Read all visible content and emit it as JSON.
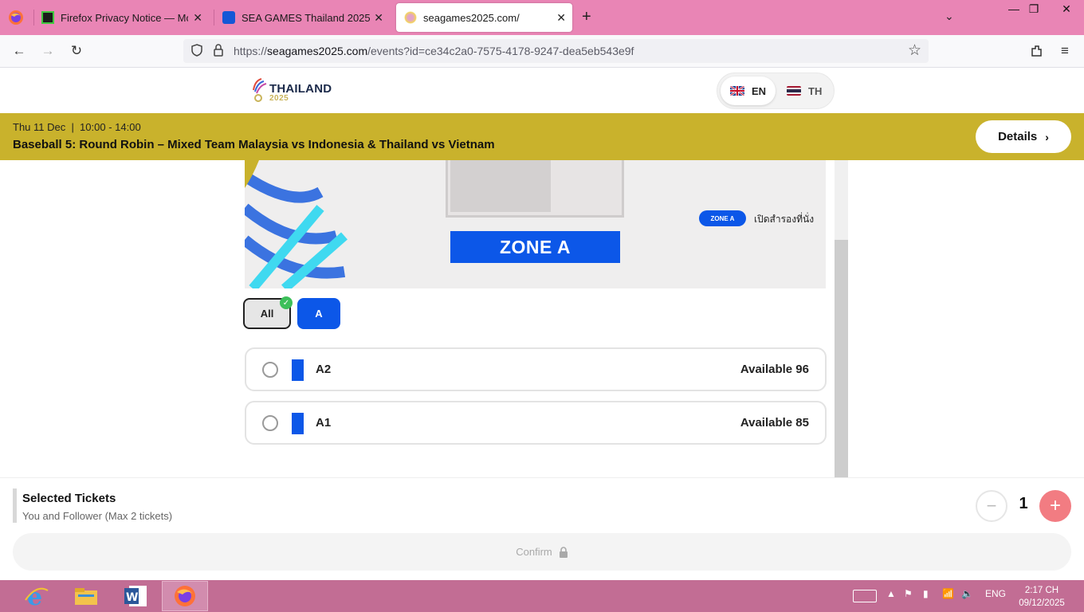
{
  "browser": {
    "tabs": [
      {
        "title": "Firefox Privacy Notice — Mozilla",
        "active": false
      },
      {
        "title": "SEA GAMES Thailand 2025",
        "active": false
      },
      {
        "title": "seagames2025.com/",
        "active": true
      }
    ],
    "url_prefix": "https://",
    "url_host": "seagames2025.com",
    "url_path": "/events?id=ce34c2a0-7575-4178-9247-dea5eb543e9f"
  },
  "site": {
    "logo_text": "THAILAND",
    "logo_year": "2025",
    "languages": [
      {
        "code": "EN",
        "selected": true
      },
      {
        "code": "TH",
        "selected": false
      }
    ]
  },
  "event": {
    "date_time": "Thu 11 Dec  |  10:00 - 14:00",
    "title": "Baseball 5: Round Robin – Mixed Team Malaysia vs Indonesia & Thailand vs Vietnam",
    "details_label": "Details"
  },
  "seat_map": {
    "zone_label": "ZONE A",
    "legend_badge": "ZONE A",
    "legend_text": "เปิดสำรองที่นั่ง"
  },
  "filters": [
    {
      "label": "All",
      "selected": true
    },
    {
      "label": "A",
      "selected": false
    }
  ],
  "zones": [
    {
      "name": "A2",
      "availability": "Available 96"
    },
    {
      "name": "A1",
      "availability": "Available 85"
    }
  ],
  "selection": {
    "title": "Selected Tickets",
    "subtitle": "You and Follower (Max 2 tickets)",
    "quantity": "1",
    "confirm_label": "Confirm"
  },
  "taskbar": {
    "language": "ENG",
    "time": "2:17 CH",
    "date": "09/12/2025"
  },
  "colors": {
    "tab_bar": "#e985b5",
    "banner": "#c9b22c",
    "zone_blue": "#0c57e8",
    "plus_button": "#f27c82",
    "taskbar": "#c26d94"
  }
}
